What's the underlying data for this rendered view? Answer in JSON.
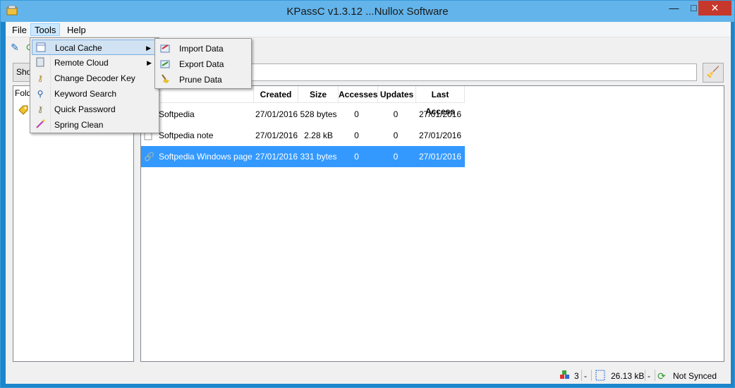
{
  "window": {
    "title": "KPassC v1.3.12 ...Nullox Software",
    "minimize": "—",
    "maximize": "□",
    "close": "✕"
  },
  "menubar": {
    "file": "File",
    "tools": "Tools",
    "help": "Help"
  },
  "toolbar": {
    "show_label": "Show"
  },
  "folders": {
    "header": "Fold"
  },
  "columns": [
    "e",
    "Created",
    "Size",
    "Accesses",
    "Updates",
    "Last Access"
  ],
  "rows": [
    {
      "name": "Softpedia",
      "created": "27/01/2016",
      "size": "528 bytes",
      "accesses": "0",
      "updates": "0",
      "last_access": "27/01/2016"
    },
    {
      "name": "Softpedia note",
      "created": "27/01/2016",
      "size": "2.28 kB",
      "accesses": "0",
      "updates": "0",
      "last_access": "27/01/2016"
    },
    {
      "name": "Softpedia Windows page",
      "created": "27/01/2016",
      "size": "331 bytes",
      "accesses": "0",
      "updates": "0",
      "last_access": "27/01/2016"
    }
  ],
  "tools_menu": [
    {
      "label": "Local Cache",
      "icon": "calendar-icon"
    },
    {
      "label": "Remote Cloud",
      "icon": "server-icon"
    },
    {
      "label": "Change Decoder Key",
      "icon": "key-icon"
    },
    {
      "label": "Keyword Search",
      "icon": "magnifier-icon"
    },
    {
      "label": "Quick Password",
      "icon": "keys-icon"
    },
    {
      "label": "Spring Clean",
      "icon": "wand-icon"
    }
  ],
  "local_cache_submenu": [
    {
      "label": "Import Data",
      "icon": "import-icon"
    },
    {
      "label": "Export Data",
      "icon": "export-icon"
    },
    {
      "label": "Prune Data",
      "icon": "broom-icon"
    }
  ],
  "status": {
    "count": "3",
    "dash1": "-",
    "size": "26.13 kB",
    "dash2": "-",
    "sync": "Not Synced"
  },
  "colors": {
    "selection": "#3399ff",
    "title_bar": "#63b4ea",
    "close_button": "#c7382c"
  }
}
